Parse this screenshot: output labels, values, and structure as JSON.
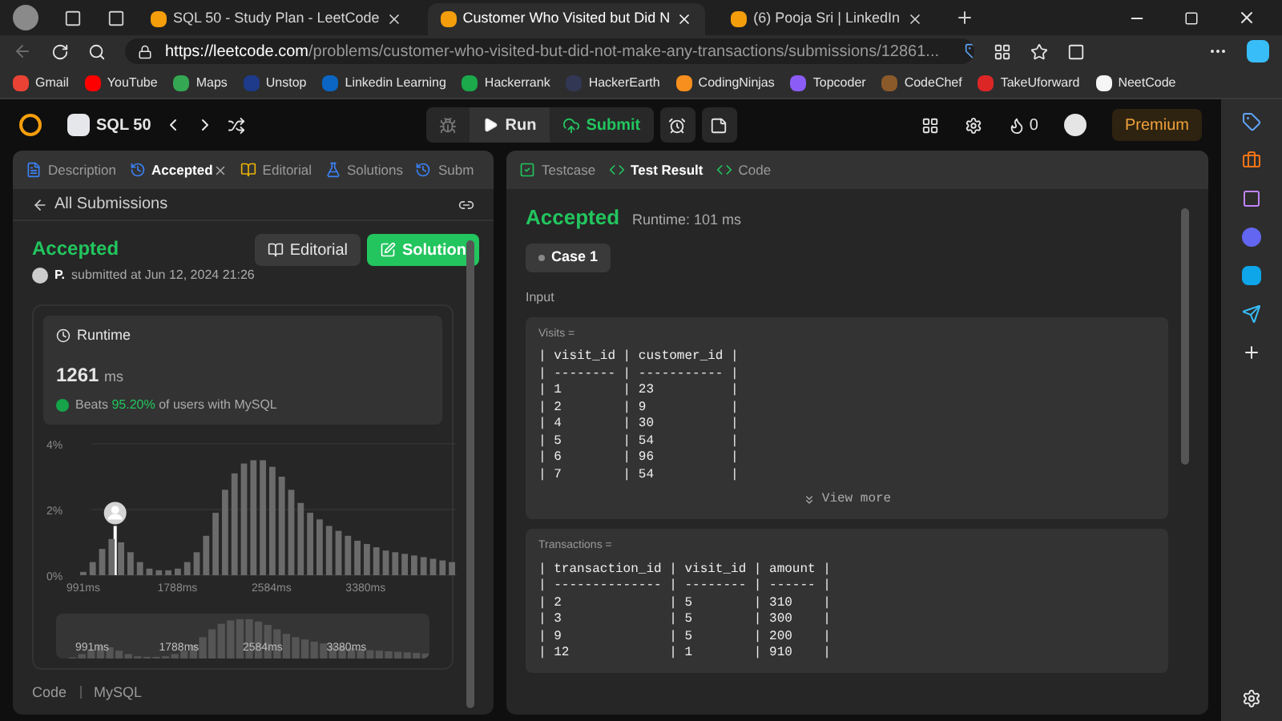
{
  "browser": {
    "tabs": [
      {
        "title": "SQL 50 - Study Plan - LeetCode",
        "selected": false
      },
      {
        "title": "Customer Who Visited but Did N",
        "selected": true
      },
      {
        "title": "(6) Pooja Sri | LinkedIn",
        "selected": false
      }
    ],
    "address": {
      "host": "https://leetcode.com",
      "path": "/problems/customer-who-visited-but-did-not-make-any-transactions/submissions/12861..."
    },
    "bookmarks": [
      {
        "label": "Gmail",
        "color": "#ea4335"
      },
      {
        "label": "YouTube",
        "color": "#ff0000"
      },
      {
        "label": "Maps",
        "color": "#34a853"
      },
      {
        "label": "Unstop",
        "color": "#1e3a8a"
      },
      {
        "label": "Linkedin Learning",
        "color": "#0a66c2"
      },
      {
        "label": "Hackerrank",
        "color": "#1ba94c"
      },
      {
        "label": "HackerEarth",
        "color": "#323754"
      },
      {
        "label": "CodingNinjas",
        "color": "#f78f1e"
      },
      {
        "label": "Topcoder",
        "color": "#8b5cf6"
      },
      {
        "label": "CodeChef",
        "color": "#8b5a2b"
      },
      {
        "label": "TakeUforward",
        "color": "#dc2626"
      },
      {
        "label": "NeetCode",
        "color": "#f5f5f5"
      }
    ]
  },
  "app": {
    "problem_list": "SQL 50",
    "run": "Run",
    "submit": "Submit",
    "streak": "0",
    "premium": "Premium"
  },
  "left_tabs": [
    {
      "label": "Description",
      "selected": false
    },
    {
      "label": "Accepted",
      "selected": true
    },
    {
      "label": "Editorial",
      "selected": false
    },
    {
      "label": "Solutions",
      "selected": false
    },
    {
      "label": "Subm",
      "selected": false
    }
  ],
  "submission": {
    "back": "All Submissions",
    "status": "Accepted",
    "author": "P.",
    "submitted": "submitted at Jun 12, 2024 21:26",
    "editorial": "Editorial",
    "solution": "Solution",
    "runtime": {
      "label": "Runtime",
      "value": "1261",
      "unit": "ms",
      "beats_prefix": "Beats",
      "beats_percent": "95.20%",
      "beats_suffix": "of users with MySQL"
    },
    "chart_data": {
      "type": "bar",
      "x": [
        991,
        1071,
        1151,
        1231,
        1311,
        1391,
        1471,
        1551,
        1631,
        1711,
        1791,
        1871,
        1951,
        2031,
        2111,
        2191,
        2271,
        2351,
        2431,
        2511,
        2591,
        2671,
        2751,
        2831,
        2911,
        2991,
        3071,
        3151,
        3231,
        3311,
        3391,
        3471,
        3551,
        3631,
        3711,
        3791,
        3871,
        3951,
        4031,
        4111
      ],
      "series": [
        {
          "color": "#6b6b6b",
          "values": [
            0.1,
            0.4,
            0.8,
            1.1,
            1.0,
            0.7,
            0.4,
            0.2,
            0.15,
            0.15,
            0.2,
            0.4,
            0.7,
            1.2,
            1.9,
            2.6,
            3.1,
            3.4,
            3.5,
            3.5,
            3.3,
            3.0,
            2.6,
            2.2,
            1.9,
            1.7,
            1.5,
            1.35,
            1.2,
            1.05,
            0.95,
            0.85,
            0.75,
            0.7,
            0.65,
            0.6,
            0.55,
            0.5,
            0.45,
            0.4
          ]
        }
      ],
      "xlim": [
        951,
        4151
      ],
      "ylim": [
        0,
        4
      ],
      "xticks": [
        {
          "value": 991,
          "label": "991ms"
        },
        {
          "value": 1788,
          "label": "1788ms"
        },
        {
          "value": 2584,
          "label": "2584ms"
        },
        {
          "value": 3380,
          "label": "3380ms"
        }
      ],
      "yticks": [
        {
          "value": 0,
          "label": "0%"
        },
        {
          "value": 2,
          "label": "2%"
        },
        {
          "value": 4,
          "label": "4%"
        }
      ]
    },
    "navigator_labels": [
      "991ms",
      "1788ms",
      "2584ms",
      "3380ms"
    ],
    "code_label": "Code",
    "language": "MySQL"
  },
  "right_tabs": [
    {
      "label": "Testcase",
      "selected": false
    },
    {
      "label": "Test Result",
      "selected": true
    },
    {
      "label": "Code",
      "selected": false
    }
  ],
  "result": {
    "status": "Accepted",
    "runtime": "Runtime: 101 ms",
    "cases": [
      {
        "label": "Case 1",
        "selected": true
      }
    ],
    "input_label": "Input",
    "inputs": [
      {
        "name": "Visits =",
        "lines": [
          "| visit_id | customer_id |",
          "| -------- | ----------- |",
          "| 1        | 23          |",
          "| 2        | 9           |",
          "| 4        | 30          |",
          "| 5        | 54          |",
          "| 6        | 96          |",
          "| 7        | 54          |"
        ],
        "more": "View more"
      },
      {
        "name": "Transactions =",
        "lines": [
          "| transaction_id | visit_id | amount |",
          "| -------------- | -------- | ------ |",
          "| 2              | 5        | 310    |",
          "| 3              | 5        | 300    |",
          "| 9              | 5        | 200    |",
          "| 12             | 1        | 910    |"
        ]
      }
    ]
  }
}
